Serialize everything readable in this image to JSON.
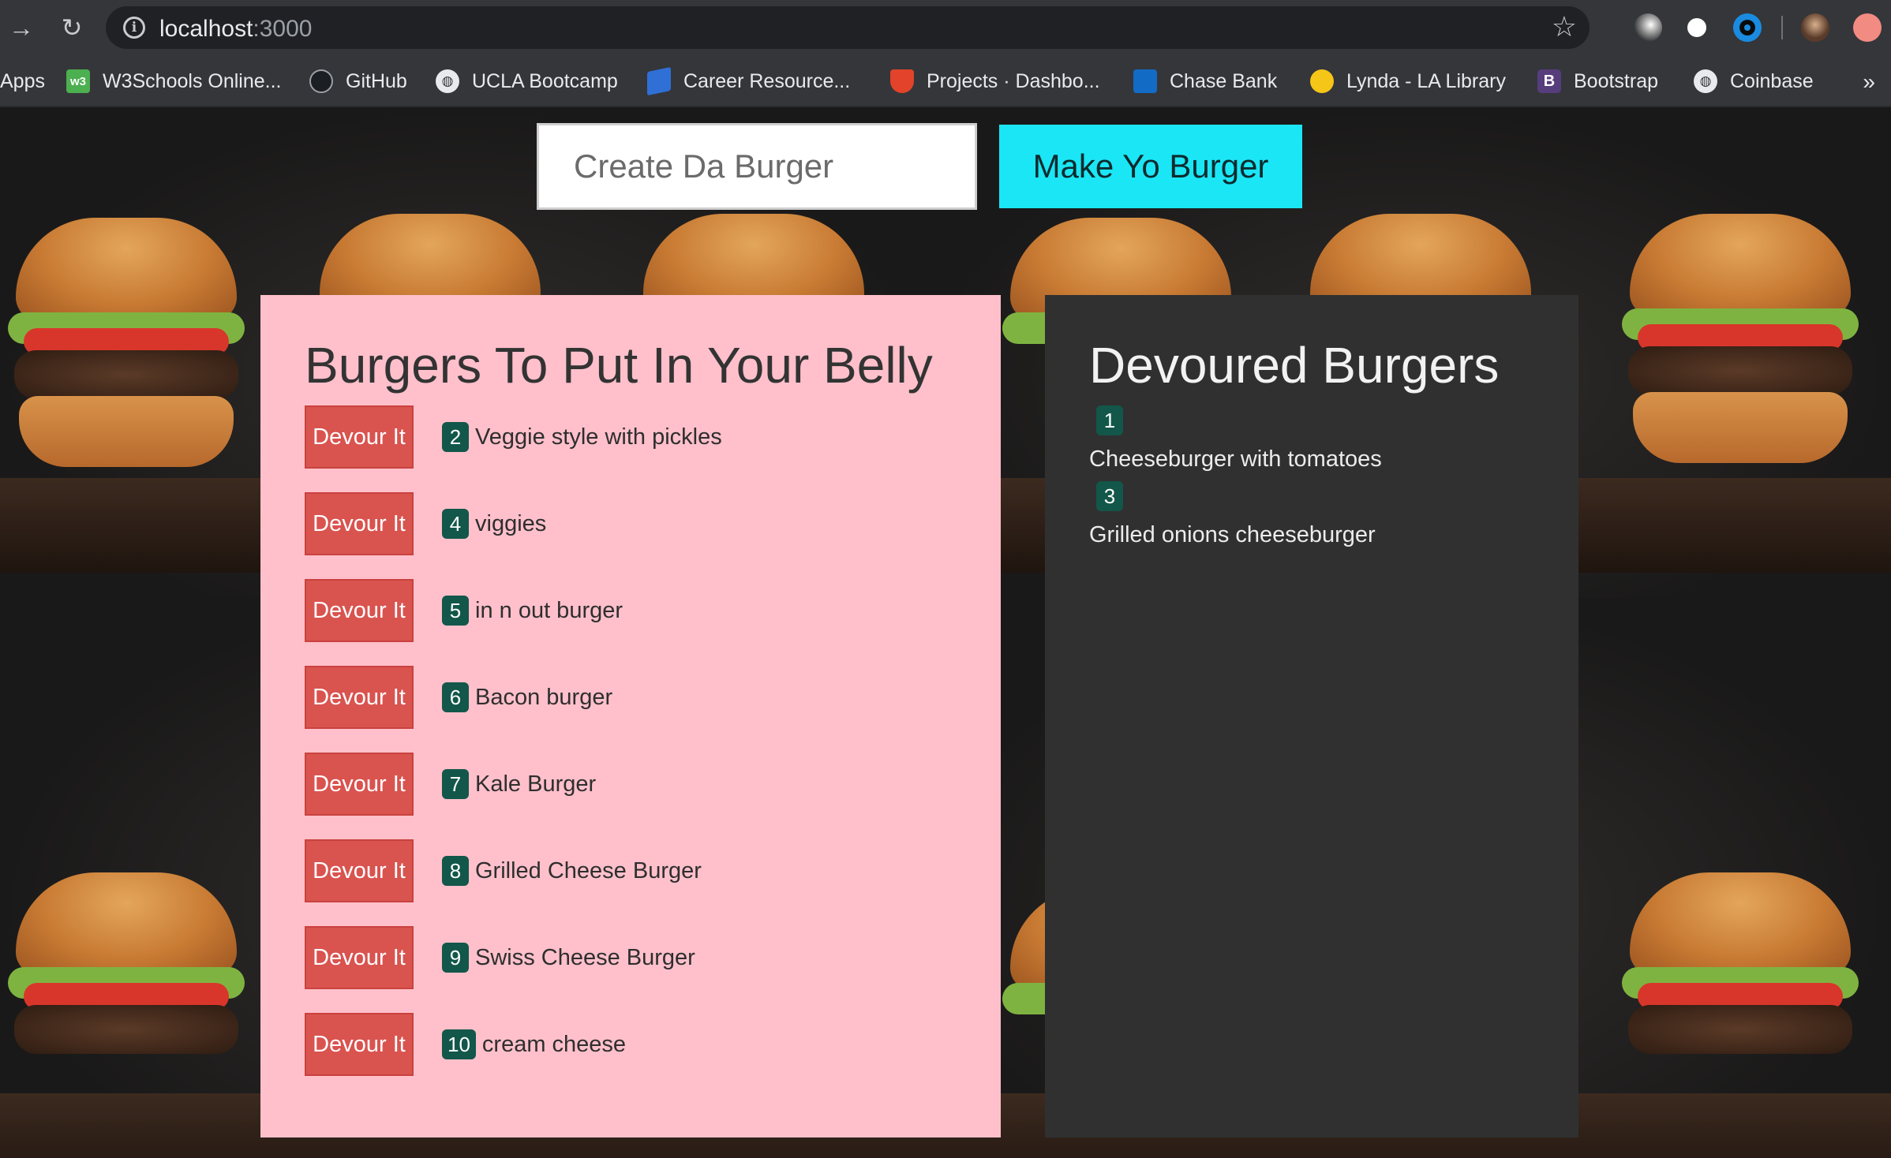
{
  "browser": {
    "url_host": "localhost",
    "url_port": ":3000",
    "bookmarks": [
      {
        "label": "Apps",
        "icon": "apps-grid-icon"
      },
      {
        "label": "W3Schools Online...",
        "icon": "w3schools-icon",
        "glyph": "w3"
      },
      {
        "label": "GitHub",
        "icon": "github-icon"
      },
      {
        "label": "UCLA Bootcamp",
        "icon": "globe-icon"
      },
      {
        "label": "Career Resource...",
        "icon": "career-icon"
      },
      {
        "label": "Projects · Dashbo...",
        "icon": "gitlab-icon"
      },
      {
        "label": "Chase Bank",
        "icon": "chase-icon"
      },
      {
        "label": "Lynda - LA Library",
        "icon": "lynda-icon"
      },
      {
        "label": "Bootstrap",
        "icon": "bootstrap-icon",
        "glyph": "B"
      },
      {
        "label": "Coinbase",
        "icon": "globe-icon"
      }
    ],
    "more_glyph": "»"
  },
  "form": {
    "input_value": "Create Da Burger",
    "submit_label": "Make Yo Burger"
  },
  "uneaten": {
    "title": "Burgers To Put In Your Belly",
    "button_label": "Devour It",
    "items": [
      {
        "id": "2",
        "name": "Veggie style with pickles"
      },
      {
        "id": "4",
        "name": "viggies"
      },
      {
        "id": "5",
        "name": "in n out burger"
      },
      {
        "id": "6",
        "name": "Bacon burger"
      },
      {
        "id": "7",
        "name": "Kale Burger"
      },
      {
        "id": "8",
        "name": "Grilled Cheese Burger"
      },
      {
        "id": "9",
        "name": "Swiss Cheese Burger"
      },
      {
        "id": "10",
        "name": "cream cheese"
      }
    ]
  },
  "devoured": {
    "title": "Devoured Burgers",
    "items": [
      {
        "id": "1",
        "name": "Cheeseburger with tomatoes"
      },
      {
        "id": "3",
        "name": "Grilled onions cheeseburger"
      }
    ]
  },
  "colors": {
    "pink_panel": "#ffc0cb",
    "dark_panel": "#303030",
    "devour_button": "#d9534f",
    "badge": "#12574a",
    "submit_button": "#1be6f5"
  }
}
